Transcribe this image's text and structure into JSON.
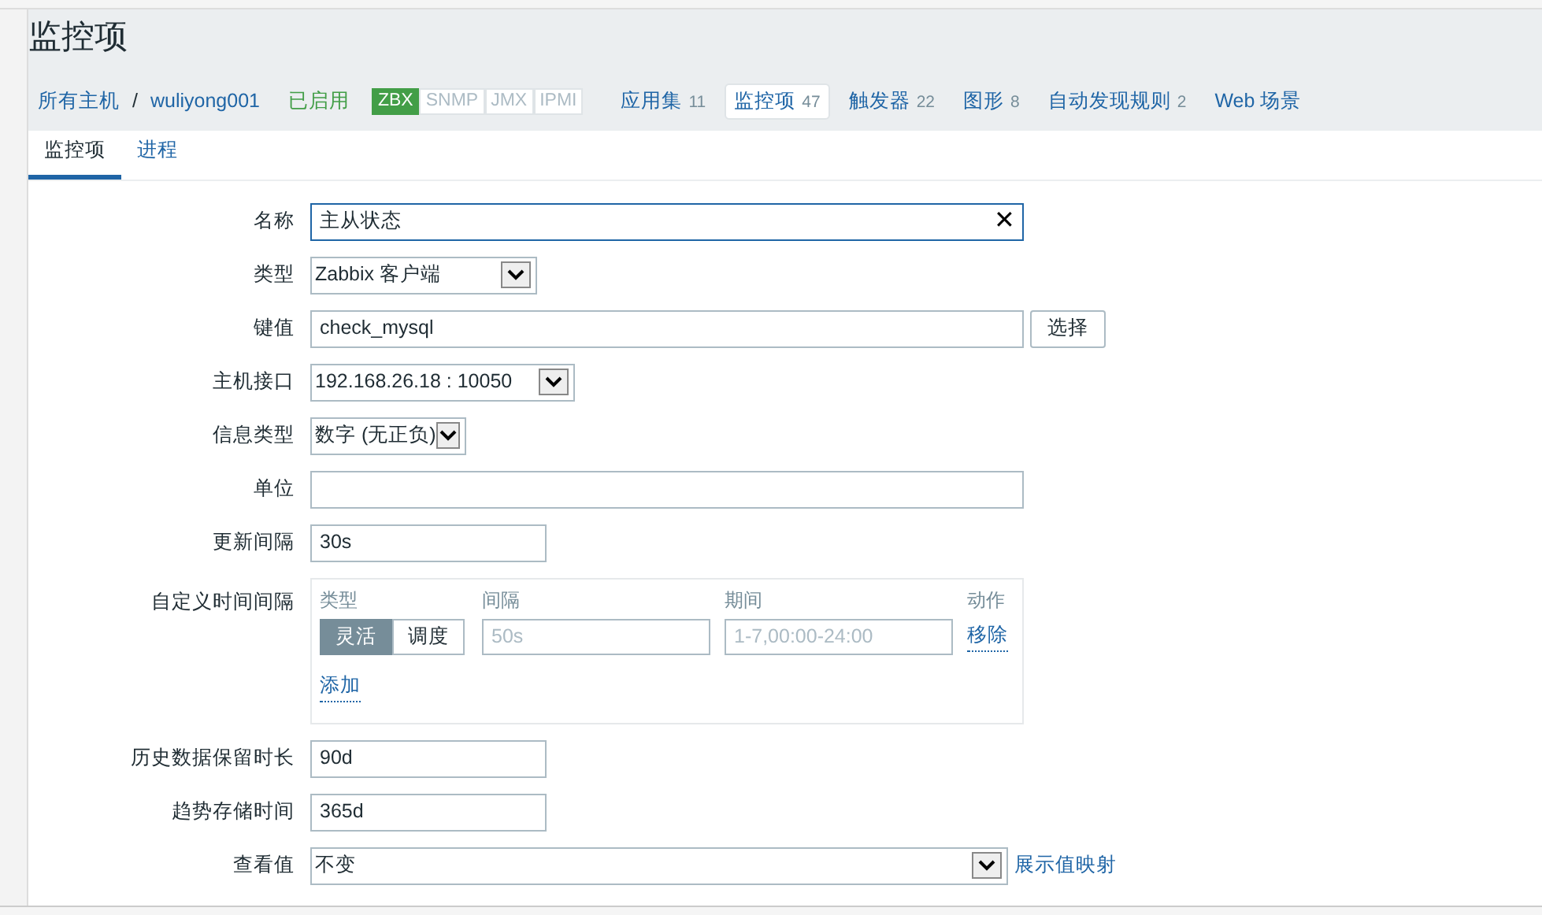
{
  "page_title": "监控项",
  "breadcrumb": [
    {
      "label": "所有主机",
      "kind": "link"
    },
    {
      "label": "/",
      "kind": "sep"
    },
    {
      "label": "wuliyong001",
      "kind": "link"
    },
    {
      "label": "已启用",
      "kind": "status"
    }
  ],
  "availability": [
    {
      "label": "ZBX",
      "on": true
    },
    {
      "label": "SNMP",
      "on": false
    },
    {
      "label": "JMX",
      "on": false
    },
    {
      "label": "IPMI",
      "on": false
    }
  ],
  "nav": [
    {
      "label": "应用集",
      "count": "11",
      "selected": false
    },
    {
      "label": "监控项",
      "count": "47",
      "selected": true
    },
    {
      "label": "触发器",
      "count": "22",
      "selected": false
    },
    {
      "label": "图形",
      "count": "8",
      "selected": false
    },
    {
      "label": "自动发现规则",
      "count": "2",
      "selected": false
    },
    {
      "label": "Web 场景",
      "selected": false
    }
  ],
  "tabs": [
    {
      "label": "监控项",
      "selected": true
    },
    {
      "label": "进程",
      "selected": false
    }
  ],
  "form": [
    {
      "kind": "text",
      "label": "名称",
      "value": "主从状态",
      "focused": true,
      "clear": "✕"
    },
    {
      "kind": "select",
      "label": "类型",
      "value": "Zabbix 客户端"
    },
    {
      "kind": "text",
      "label": "键值",
      "value": "check_mysql",
      "button": "选择"
    },
    {
      "kind": "select",
      "label": "主机接口",
      "value": "192.168.26.18 : 10050"
    },
    {
      "kind": "select",
      "label": "信息类型",
      "value": "数字 (无正负)"
    },
    {
      "kind": "text",
      "label": "单位"
    },
    {
      "kind": "text",
      "label": "更新间隔",
      "value": "30s"
    },
    {
      "kind": "intervals",
      "label": "自定义时间间隔",
      "headers": [
        "类型",
        "间隔",
        "期间",
        "动作"
      ],
      "modes": [
        {
          "label": "灵活",
          "selected": true
        },
        {
          "label": "调度",
          "selected": false
        }
      ],
      "interval_placeholder": "50s",
      "period_placeholder": "1-7,00:00-24:00",
      "remove": "移除",
      "add": "添加"
    },
    {
      "kind": "text",
      "label": "历史数据保留时长",
      "value": "90d"
    },
    {
      "kind": "text",
      "label": "趋势存储时间",
      "value": "365d"
    },
    {
      "kind": "select",
      "label": "查看值",
      "value": "不变",
      "link": "展示值映射"
    }
  ]
}
